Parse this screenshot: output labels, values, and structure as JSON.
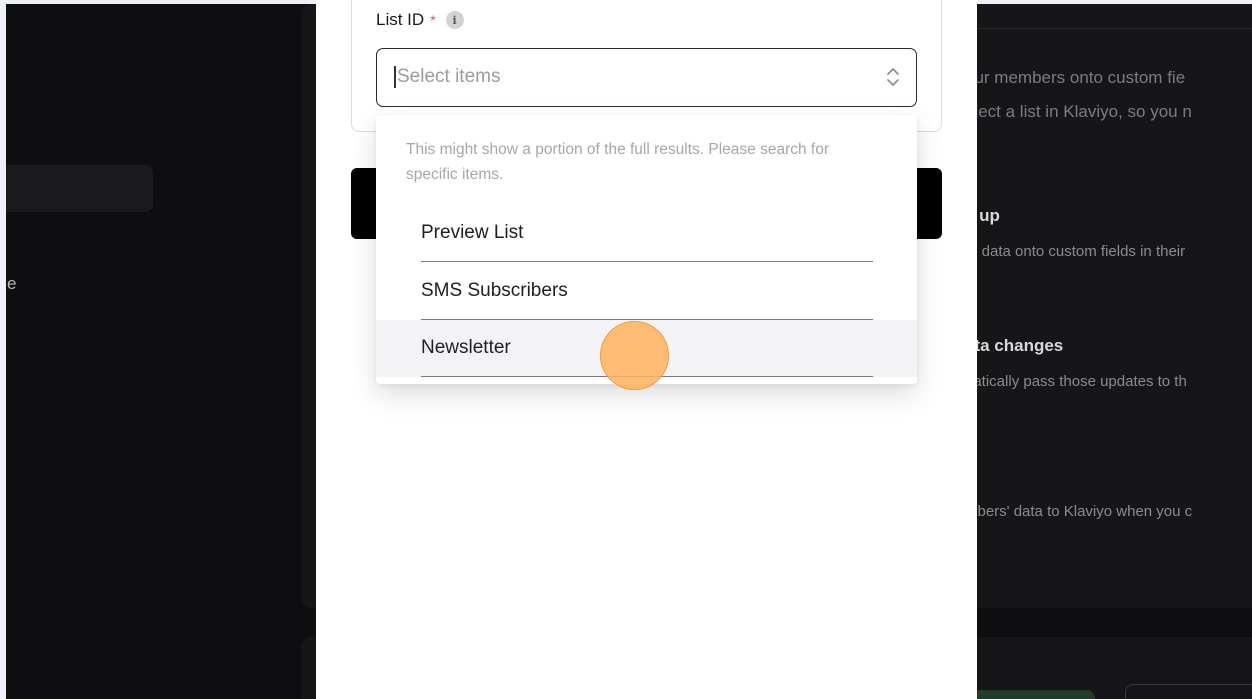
{
  "background": {
    "nav_letter": "e",
    "right_panel": {
      "line1": "our members onto custom fie",
      "line2": "elect a list in Klaviyo, so you n",
      "heading1": "s up",
      "text1": "te data onto custom fields in their",
      "heading2": "ata changes",
      "text2": "natically pass those updates to th",
      "text3": "mbers' data to Klaviyo when you c"
    }
  },
  "form": {
    "list_id_label": "List ID",
    "required_mark": "*",
    "info_glyph": "i",
    "select": {
      "placeholder": "Select items",
      "value": ""
    }
  },
  "dropdown": {
    "hint": "This might show a portion of the full results. Please search for specific items.",
    "items": [
      {
        "label": "Preview List"
      },
      {
        "label": "SMS Subscribers"
      },
      {
        "label": "Newsletter",
        "hovered": true
      }
    ]
  },
  "colors": {
    "required": "#d9534f",
    "click_indicator": "#ffb25e",
    "overlay_bg": "#0e0e10"
  }
}
